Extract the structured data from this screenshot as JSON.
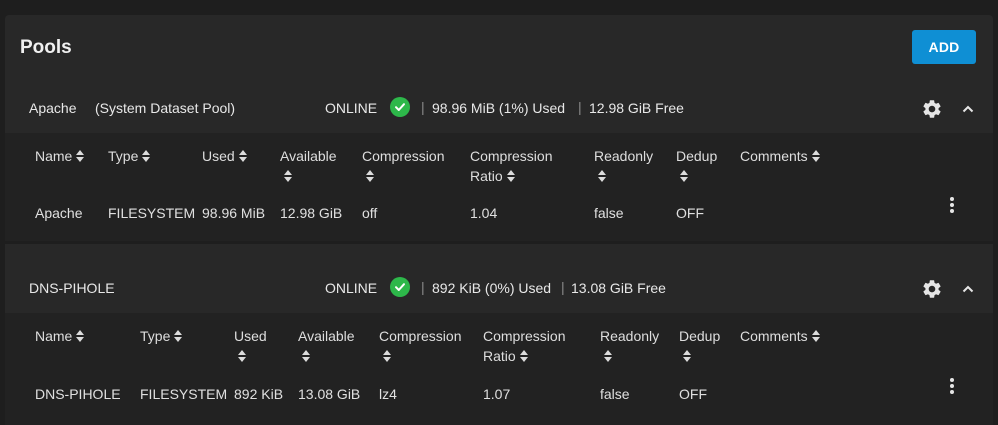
{
  "page": {
    "title": "Pools",
    "add_label": "ADD"
  },
  "pools": [
    {
      "name": "Apache",
      "subtitle": "(System Dataset Pool)",
      "status": "ONLINE",
      "used": "98.96 MiB (1%) Used",
      "free": "12.98 GiB Free",
      "columns": [
        "Name",
        "Type",
        "Used",
        "Available",
        "Compression",
        "Compression",
        "Ratio",
        "Readonly",
        "Dedup",
        "Comments"
      ],
      "row": {
        "name": "Apache",
        "type": "FILESYSTEM",
        "used": "98.96 MiB",
        "available": "12.98 GiB",
        "compression": "off",
        "ratio": "1.04",
        "readonly": "false",
        "dedup": "OFF",
        "comments": ""
      }
    },
    {
      "name": "DNS-PIHOLE",
      "subtitle": "",
      "status": "ONLINE",
      "used": "892 KiB (0%) Used",
      "free": "13.08 GiB Free",
      "columns": [
        "Name",
        "Type",
        "Used",
        "Available",
        "Compression",
        "Compression",
        "Ratio",
        "Readonly",
        "Dedup",
        "Comments"
      ],
      "row": {
        "name": "DNS-PIHOLE",
        "type": "FILESYSTEM",
        "used": "892 KiB",
        "available": "13.08 GiB",
        "compression": "lz4",
        "ratio": "1.07",
        "readonly": "false",
        "dedup": "OFF",
        "comments": ""
      }
    }
  ],
  "colors": {
    "accent": "#0f8fd4",
    "online": "#2db84a",
    "card": "#282828",
    "table": "#222222",
    "background": "#1e1e1e"
  },
  "icons": [
    "check-circle-icon",
    "gear-icon",
    "chevron-up-icon",
    "more-vert-icon",
    "sort-icon"
  ]
}
